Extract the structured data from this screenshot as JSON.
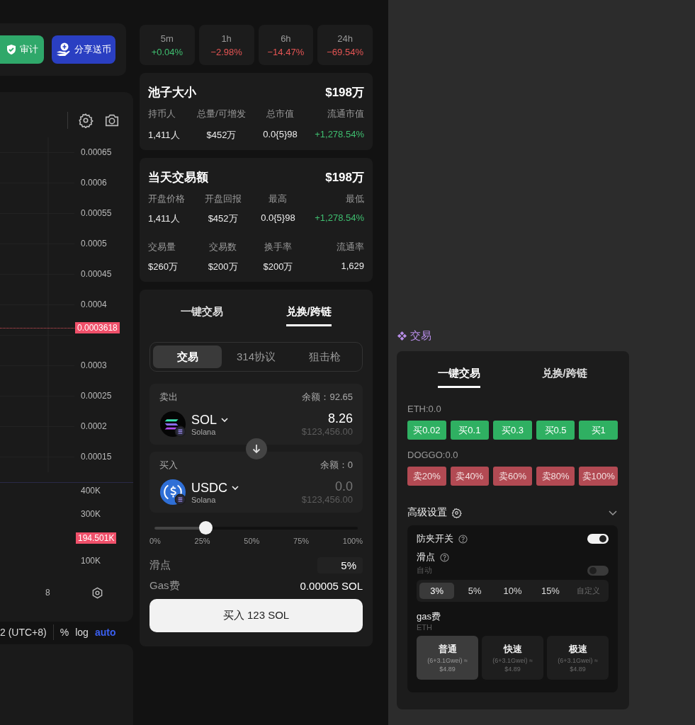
{
  "top_actions": [
    {
      "label": "审计",
      "kind": "audit"
    },
    {
      "label": "分享送币",
      "kind": "share"
    }
  ],
  "chart": {
    "price_labels": [
      "0.00065",
      "0.0006",
      "0.00055",
      "0.0005",
      "0.00045",
      "0.0004"
    ],
    "price_labels_below": [
      "0.0003",
      "0.00025",
      "0.0002",
      "0.00015"
    ],
    "current_price": "0.0003618",
    "volume_labels": [
      "400K",
      "300K"
    ],
    "current_volume": "194.501K",
    "volume_labels_below": [
      "100K"
    ],
    "time_label": "8"
  },
  "chart_footer": {
    "timezone": "2 (UTC+8)",
    "options": [
      {
        "label": "%",
        "selected": false
      },
      {
        "label": "log",
        "selected": false
      },
      {
        "label": "auto",
        "selected": true
      }
    ]
  },
  "periods": [
    {
      "label": "5m",
      "change": "+0.04%",
      "color": "#3fbf70"
    },
    {
      "label": "1h",
      "change": "−2.98%",
      "color": "#e65554"
    },
    {
      "label": "6h",
      "change": "−14.47%",
      "color": "#e65554"
    },
    {
      "label": "24h",
      "change": "−69.54%",
      "color": "#e65554"
    }
  ],
  "pool": {
    "title": "池子大小",
    "value": "$198万",
    "stats": [
      {
        "label": "持币人",
        "value": "1,411人",
        "color": "#eeeeee"
      },
      {
        "label": "总量/可增发",
        "value": "$452万",
        "color": "#eeeeee"
      },
      {
        "label": "总市值",
        "value": "0.0{5}98",
        "color": "#eeeeee"
      },
      {
        "label": "流通市值",
        "value": "+1,278.54%",
        "color": "#3fbf70"
      }
    ]
  },
  "daily": {
    "title": "当天交易额",
    "value": "$198万",
    "stats": [
      {
        "label": "开盘价格",
        "value": "1,411人",
        "color": "#eeeeee"
      },
      {
        "label": "开盘回报",
        "value": "$452万",
        "color": "#eeeeee"
      },
      {
        "label": "最高",
        "value": "0.0{5}98",
        "color": "#eeeeee"
      },
      {
        "label": "最低",
        "value": "+1,278.54%",
        "color": "#3fbf70"
      },
      {
        "label": "交易量",
        "value": "$260万",
        "color": "#eeeeee"
      },
      {
        "label": "交易数",
        "value": "$200万",
        "color": "#eeeeee"
      },
      {
        "label": "换手率",
        "value": "$200万",
        "color": "#eeeeee"
      },
      {
        "label": "流通率",
        "value": "1,629",
        "color": "#eeeeee"
      }
    ]
  },
  "trade_panel": {
    "tabs": [
      {
        "label": "一键交易",
        "selected": false
      },
      {
        "label": "兑换/跨链",
        "selected": true
      }
    ],
    "modes": [
      {
        "label": "交易",
        "selected": true
      },
      {
        "label": "314协议",
        "selected": false
      },
      {
        "label": "狙击枪",
        "selected": false
      }
    ],
    "sell": {
      "label": "卖出",
      "balance": "余额：92.65",
      "token": "SOL",
      "kind": "sol",
      "chain": "Solana",
      "value": "8.26",
      "usd": "$123,456.00"
    },
    "buy": {
      "label": "买入",
      "balance": "余额：0",
      "token": "USDC",
      "kind": "usdc",
      "chain": "Solana",
      "placeholder": "0.0",
      "usd": "$123,456.00"
    },
    "slider": {
      "level": 0.25,
      "marks": [
        "0%",
        "25%",
        "50%",
        "75%",
        "100%"
      ]
    },
    "slippage": {
      "label": "滑点",
      "value": "5%"
    },
    "gas": {
      "label": "Gas费",
      "value": "0.00005 SOL"
    },
    "submit": "买入 123 SOL"
  },
  "frame": {
    "title": "交易",
    "tabs": [
      {
        "label": "一键交易",
        "selected": true
      },
      {
        "label": "兑换/跨链",
        "selected": false
      }
    ],
    "eth_balance": "ETH:0.0",
    "buy_buttons": [
      "买0.02",
      "买0.1",
      "买0.3",
      "买0.5",
      "买1"
    ],
    "token_balance": "DOGGO:0.0",
    "sell_buttons": [
      "卖20%",
      "卖40%",
      "卖60%",
      "卖80%",
      "卖100%"
    ],
    "advanced": {
      "title": "高级设置",
      "anti_mev": {
        "label": "防夹开关",
        "on": true
      },
      "slippage": {
        "label": "滑点",
        "auto_label": "自动",
        "auto": false,
        "options": [
          {
            "label": "3%",
            "kind": "preset",
            "selected": true
          },
          {
            "label": "5%",
            "kind": "preset",
            "selected": false
          },
          {
            "label": "10%",
            "kind": "preset",
            "selected": false
          },
          {
            "label": "15%",
            "kind": "preset",
            "selected": false
          },
          {
            "label": "自定义",
            "kind": "custom",
            "selected": false
          }
        ]
      },
      "gas": {
        "label": "gas费",
        "unit": "ETH",
        "options": [
          {
            "name": "普通",
            "detail": "(6+3.1Gwei) ≈",
            "price": "$4.89",
            "selected": true
          },
          {
            "name": "快速",
            "detail": "(6+3.1Gwei) ≈",
            "price": "$4.89",
            "selected": false
          },
          {
            "name": "极速",
            "detail": "(6+3.1Gwei) ≈",
            "price": "$4.89",
            "selected": false
          }
        ]
      }
    }
  }
}
